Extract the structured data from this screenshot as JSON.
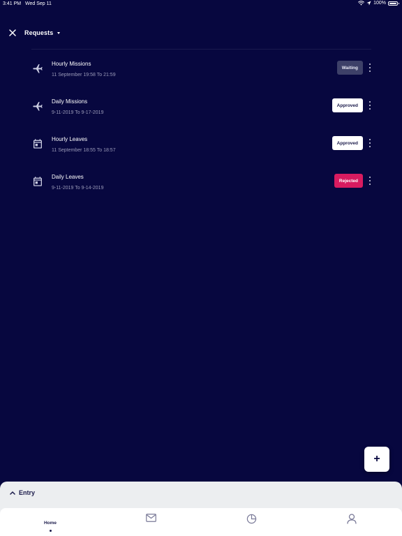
{
  "status_bar": {
    "time": "3:41 PM",
    "date": "Wed Sep 11",
    "battery": "100%"
  },
  "header": {
    "title": "Requests"
  },
  "requests": [
    {
      "title": "Hourly Missions",
      "subtitle": "11 September 19:58 To 21:59",
      "status": "Waiting",
      "icon": "airplane-icon"
    },
    {
      "title": "Daily Missions",
      "subtitle": "9-11-2019 To 9-17-2019",
      "status": "Approved",
      "icon": "airplane-icon"
    },
    {
      "title": "Hourly Leaves",
      "subtitle": "11 September 18:55 To 18:57",
      "status": "Approved",
      "icon": "calendar-icon"
    },
    {
      "title": "Daily Leaves",
      "subtitle": "9-11-2019 To 9-14-2019",
      "status": "Rejected",
      "icon": "calendar-icon"
    }
  ],
  "fab": {
    "label": "+"
  },
  "entry": {
    "label": "Entry"
  },
  "bottom_nav": {
    "home_label": "Home"
  },
  "colors": {
    "background": "#07073f",
    "waiting": "#3d4068",
    "approved": "#ffffff",
    "rejected": "#d81b60"
  }
}
